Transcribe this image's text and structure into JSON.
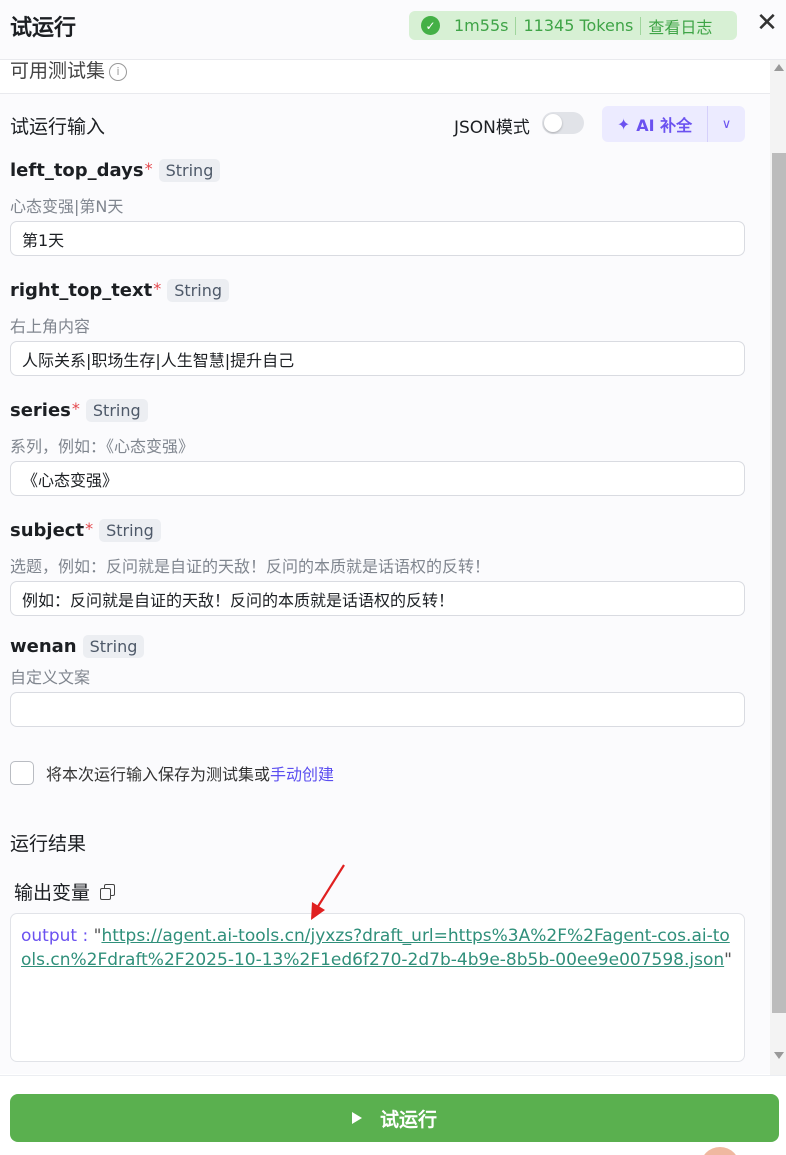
{
  "header": {
    "title": "试运行",
    "status": {
      "time": "1m55s",
      "tokens": "11345 Tokens",
      "log_link": "查看日志"
    },
    "close_glyph": "✕"
  },
  "test_set": {
    "label": "可用测试集",
    "info_glyph": "i"
  },
  "input_section": {
    "title": "试运行输入",
    "json_mode_label": "JSON模式",
    "json_mode_on": false,
    "ai_fill_label": "AI 补全",
    "ai_fill_icon": "sparkle-icon"
  },
  "fields": [
    {
      "name": "left_top_days",
      "required": true,
      "type": "String",
      "description": "心态变强|第N天",
      "value": "第1天"
    },
    {
      "name": "right_top_text",
      "required": true,
      "type": "String",
      "description": "右上角内容",
      "value": "人际关系|职场生存|人生智慧|提升自己"
    },
    {
      "name": "series",
      "required": true,
      "type": "String",
      "description": "系列，例如：《心态变强》",
      "value": "《心态变强》"
    },
    {
      "name": "subject",
      "required": true,
      "type": "String",
      "description": "选题，例如：反问就是自证的天敌！反问的本质就是话语权的反转！",
      "value": "例如：反问就是自证的天敌！反问的本质就是话语权的反转！"
    },
    {
      "name": "wenan",
      "required": false,
      "type": "String",
      "description": "自定义文案",
      "value": ""
    }
  ],
  "save": {
    "text": "将本次运行输入保存为测试集或",
    "link": "手动创建",
    "checked": false
  },
  "result": {
    "title": "运行结果",
    "output_label": "输出变量",
    "output_key": "output",
    "output_colon": " : ",
    "output_url": "https://agent.ai-tools.cn/jyxzs?draft_url=https%3A%2F%2Fagent-cos.ai-tools.cn%2Fdraft%2F2025-10-13%2F1ed6f270-2d7b-4b9e-8b5b-00ee9e007598.json"
  },
  "run_button": {
    "label": "试运行"
  },
  "colors": {
    "accent_purple": "#6b52f0",
    "run_green": "#5ab04f",
    "status_green": "#3fa447",
    "required_red": "#e5484d"
  }
}
